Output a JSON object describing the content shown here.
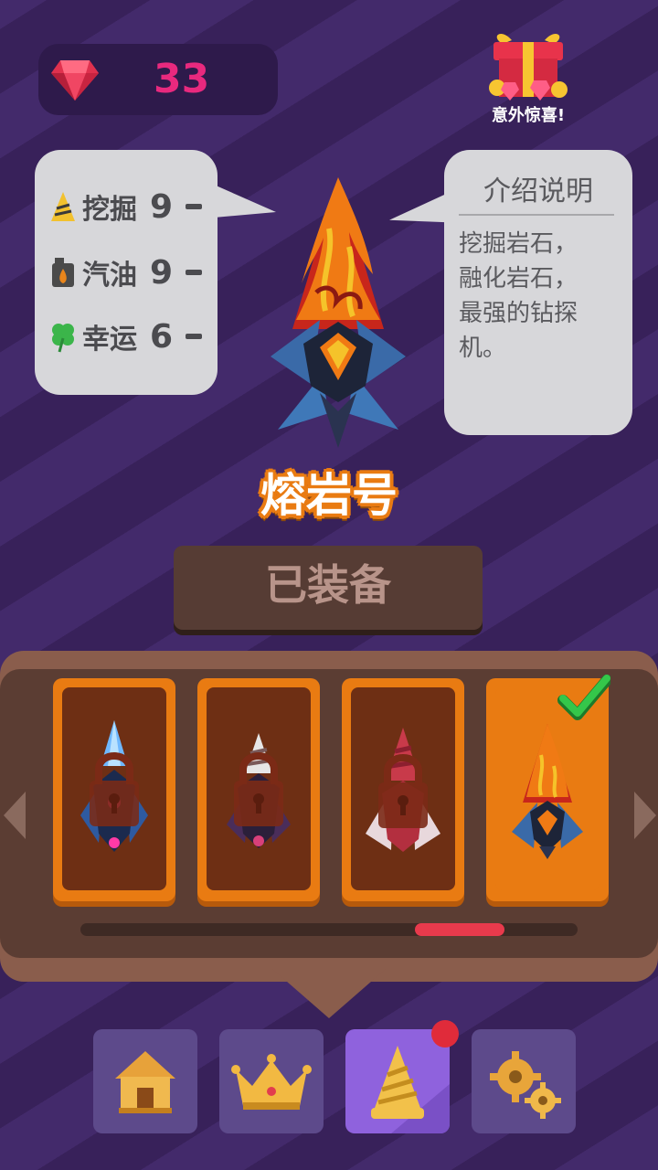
{
  "currency": {
    "icon": "ruby-gem-icon",
    "count": "33"
  },
  "gift": {
    "icon": "gift-box-icon",
    "label": "意外惊喜!"
  },
  "stats": [
    {
      "icon": "drill-cone-icon",
      "label": "挖掘",
      "value": "9"
    },
    {
      "icon": "fuel-can-icon",
      "label": "汽油",
      "value": "9"
    },
    {
      "icon": "clover-icon",
      "label": "幸运",
      "value": "6"
    }
  ],
  "info": {
    "title": "介绍说明",
    "lines": [
      "挖掘岩石，",
      "融化岩石，",
      "最强的钻探",
      "机。"
    ]
  },
  "drill": {
    "name": "熔岩号",
    "icon": "lava-drill-icon"
  },
  "equip_button": {
    "label": "已装备"
  },
  "carousel": {
    "cards": [
      {
        "name": "crystal-drill",
        "locked": true,
        "selected": false
      },
      {
        "name": "striped-drill",
        "locked": true,
        "selected": false
      },
      {
        "name": "red-drill",
        "locked": true,
        "selected": false
      },
      {
        "name": "lava-drill",
        "locked": false,
        "selected": true
      }
    ],
    "scroll_position": 0.82
  },
  "nav": [
    {
      "icon": "house-icon",
      "active": false
    },
    {
      "icon": "crown-icon",
      "active": false
    },
    {
      "icon": "drill-icon",
      "active": true,
      "badge": true
    },
    {
      "icon": "gears-icon",
      "active": false
    }
  ],
  "colors": {
    "accent": "#e97b12",
    "gem": "#e8297e",
    "background": "#3e2763",
    "alert": "#e83a4c"
  }
}
